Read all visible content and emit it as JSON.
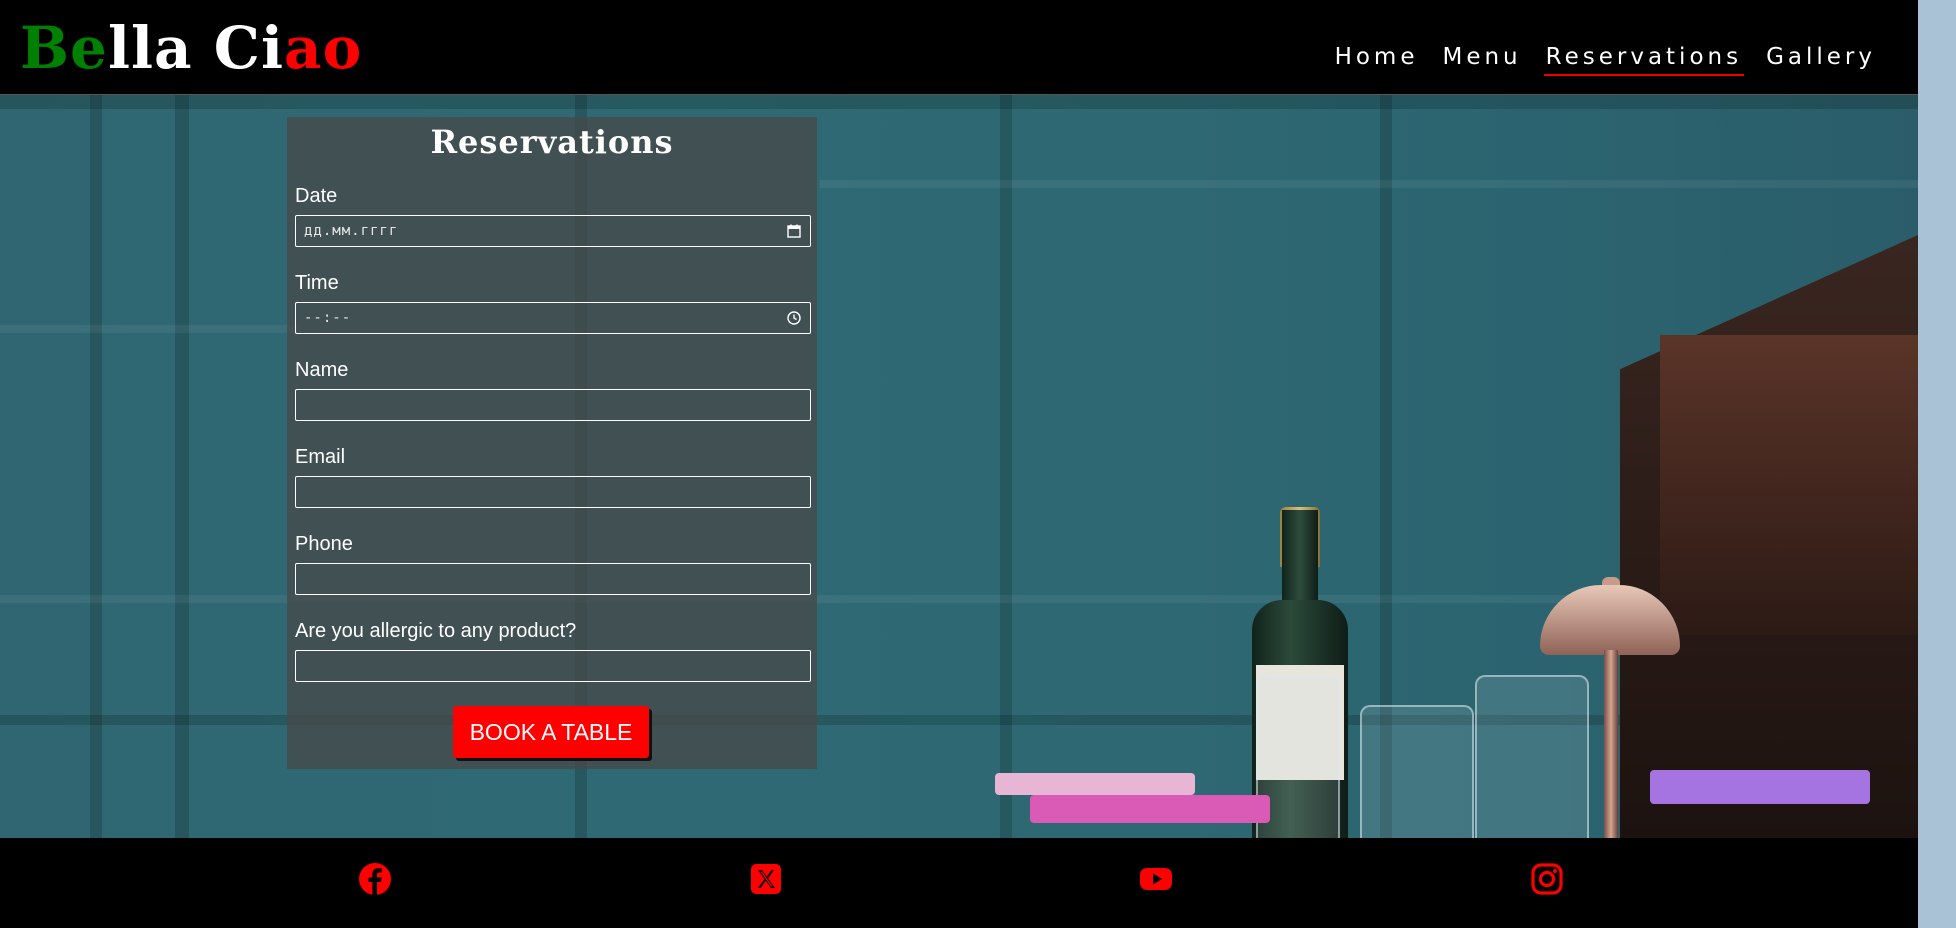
{
  "brand": {
    "parts": [
      {
        "text": "Be",
        "color": "#008000"
      },
      {
        "text": "lla Ci",
        "color": "#ffffff"
      },
      {
        "text": "ao",
        "color": "#ff0000"
      }
    ]
  },
  "nav": {
    "items": [
      {
        "label": "Home",
        "active": false
      },
      {
        "label": "Menu",
        "active": false
      },
      {
        "label": "Reservations",
        "active": true
      },
      {
        "label": "Gallery",
        "active": false
      }
    ],
    "active_color": "#ff0000"
  },
  "form": {
    "title": "Reservations",
    "fields": {
      "date": {
        "label": "Date",
        "value": "дд.мм.гггг",
        "icon": "calendar-icon"
      },
      "time": {
        "label": "Time",
        "value": "--:--",
        "icon": "clock-icon"
      },
      "name": {
        "label": "Name",
        "value": ""
      },
      "email": {
        "label": "Email",
        "value": ""
      },
      "phone": {
        "label": "Phone",
        "value": ""
      },
      "allergy": {
        "label": "Are you allergic to any product?",
        "value": ""
      }
    },
    "submit_label": "BOOK A TABLE",
    "submit_color": "#ff0000"
  },
  "footer": {
    "icon_color": "#ff0000",
    "social": [
      {
        "icon": "facebook-icon"
      },
      {
        "icon": "x-twitter-icon"
      },
      {
        "icon": "youtube-icon"
      },
      {
        "icon": "instagram-icon"
      }
    ]
  }
}
